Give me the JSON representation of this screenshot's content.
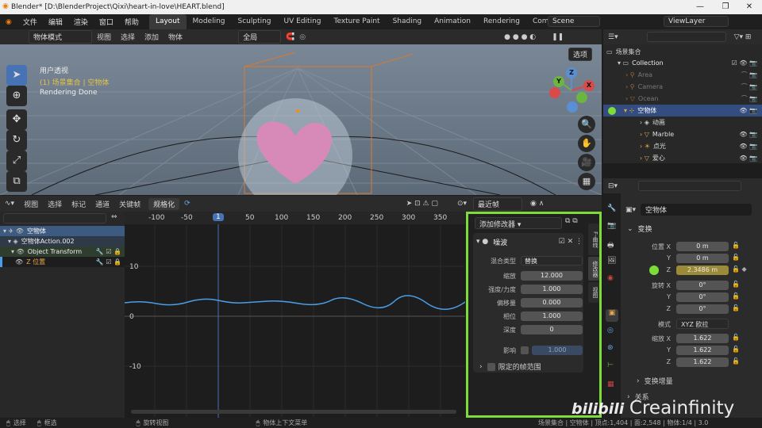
{
  "window": {
    "title": "Blender* [D:\\BlenderProject\\Qixi\\heart-in-love\\HEART.blend]"
  },
  "menubar": {
    "menus": [
      "文件",
      "编辑",
      "渲染",
      "窗口",
      "帮助"
    ],
    "workspaces": [
      "Layout",
      "Modeling",
      "Sculpting",
      "UV Editing",
      "Texture Paint",
      "Shading",
      "Animation",
      "Rendering",
      "Compositing"
    ],
    "scene": "Scene",
    "view_layer": "ViewLayer"
  },
  "viewport_header": {
    "mode": "物体模式",
    "menus": [
      "视图",
      "选择",
      "添加",
      "物体"
    ],
    "orientation": "全局",
    "options": "选项"
  },
  "viewport": {
    "view_name": "用户透视",
    "collection_path": "(1) 场景集合 | 空物体",
    "render_status": "Rendering Done",
    "gizmo": {
      "z": "Z",
      "y": "Y",
      "x": "X"
    }
  },
  "graph_header": {
    "menus": [
      "视图",
      "选择",
      "标记",
      "通道",
      "关键帧"
    ],
    "normalize": "规格化",
    "interp": "最近帧"
  },
  "graph": {
    "frame_ticks": [
      "-100",
      "-50",
      "1",
      "50",
      "100",
      "150",
      "200",
      "250",
      "300",
      "350"
    ],
    "current_frame": "1",
    "y_ticks": [
      "10",
      "0",
      "-10"
    ]
  },
  "channels": [
    {
      "label": "空物体",
      "level": 0
    },
    {
      "label": "空物体Action.002",
      "level": 1
    },
    {
      "label": "Object Transform",
      "level": 2
    },
    {
      "label": "Z 位置",
      "level": 3
    }
  ],
  "modifier_panel": {
    "add_modifier": "添加修改器",
    "name": "噪波",
    "blend_type_label": "混合类型",
    "blend_type": "替换",
    "rows": [
      {
        "label": "缩放",
        "value": "12.000"
      },
      {
        "label": "强度/力度",
        "value": "1.000"
      },
      {
        "label": "偏移量",
        "value": "0.000"
      },
      {
        "label": "相位",
        "value": "1.000"
      },
      {
        "label": "深度",
        "value": "0"
      }
    ],
    "influence_label": "影响",
    "influence_value": "1.000",
    "restrict_range": "限定的帧范围",
    "side_tabs": [
      "F-曲线",
      "修改器",
      "视图"
    ]
  },
  "outliner": {
    "header": "场景集合",
    "rows": [
      {
        "label": "Collection",
        "indent": 1
      },
      {
        "label": "Area",
        "indent": 2
      },
      {
        "label": "Camera",
        "indent": 2
      },
      {
        "label": "Ocean",
        "indent": 2
      },
      {
        "label": "空物体",
        "indent": 2
      },
      {
        "label": "动画",
        "indent": 3
      },
      {
        "label": "Marble",
        "indent": 3
      },
      {
        "label": "点光",
        "indent": 3
      },
      {
        "label": "爱心",
        "indent": 3
      }
    ]
  },
  "properties": {
    "object_name": "空物体",
    "transform_label": "变换",
    "location": {
      "label": "位置",
      "x": "0 m",
      "y": "0 m",
      "z": "2.3486 m"
    },
    "rotation": {
      "label": "旋转",
      "x": "0°",
      "y": "0°",
      "z": "0°"
    },
    "mode_label": "模式",
    "mode": "XYZ 欧拉",
    "scale": {
      "label": "缩放",
      "x": "1.622",
      "y": "1.622",
      "z": "1.622"
    },
    "delta": "变换增量",
    "relations": "关系"
  },
  "status": {
    "items": [
      "选择",
      "框选",
      "旋转视图",
      "物体上下文菜单"
    ],
    "right": "场景集合 | 空物体 | 顶点:1,404 | 面:2,548 | 物体:1/4 | 3.0"
  },
  "watermark": "Creainfinity",
  "colors": {
    "highlight": "#7ddc3a",
    "accent": "#4772b3",
    "curve": "#4a9de8"
  }
}
